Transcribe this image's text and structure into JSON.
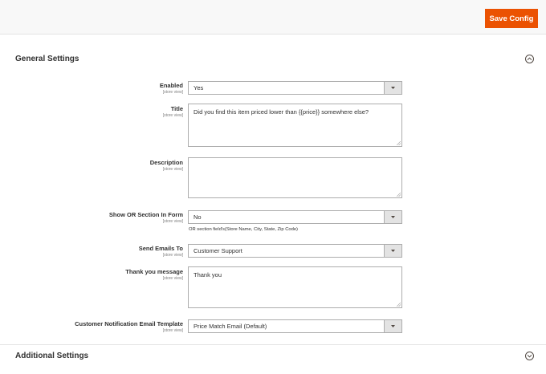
{
  "toolbar": {
    "save_label": "Save Config"
  },
  "sections": {
    "general": {
      "title": "General Settings",
      "icon": "collapse-chevron-up-icon"
    },
    "additional": {
      "title": "Additional Settings",
      "icon": "expand-chevron-down-icon"
    }
  },
  "scope_label": "[store view]",
  "fields": {
    "enabled": {
      "label": "Enabled",
      "value": "Yes"
    },
    "title": {
      "label": "Title",
      "value": "Did you find this item priced lower than {{price}} somewhere else?"
    },
    "description": {
      "label": "Description",
      "value": ""
    },
    "show_or_section": {
      "label": "Show OR Section In Form",
      "value": "No",
      "note": "OR section field's(Store Name, City, State, Zip Code)"
    },
    "send_emails_to": {
      "label": "Send Emails To",
      "value": "Customer Support"
    },
    "thank_you": {
      "label": "Thank you message",
      "value": "Thank you"
    },
    "notification_template": {
      "label": "Customer Notification Email Template",
      "value": "Price Match Email (Default)"
    }
  },
  "colors": {
    "accent": "#eb5202",
    "border": "#adadad",
    "topbar": "#f8f8f8"
  }
}
